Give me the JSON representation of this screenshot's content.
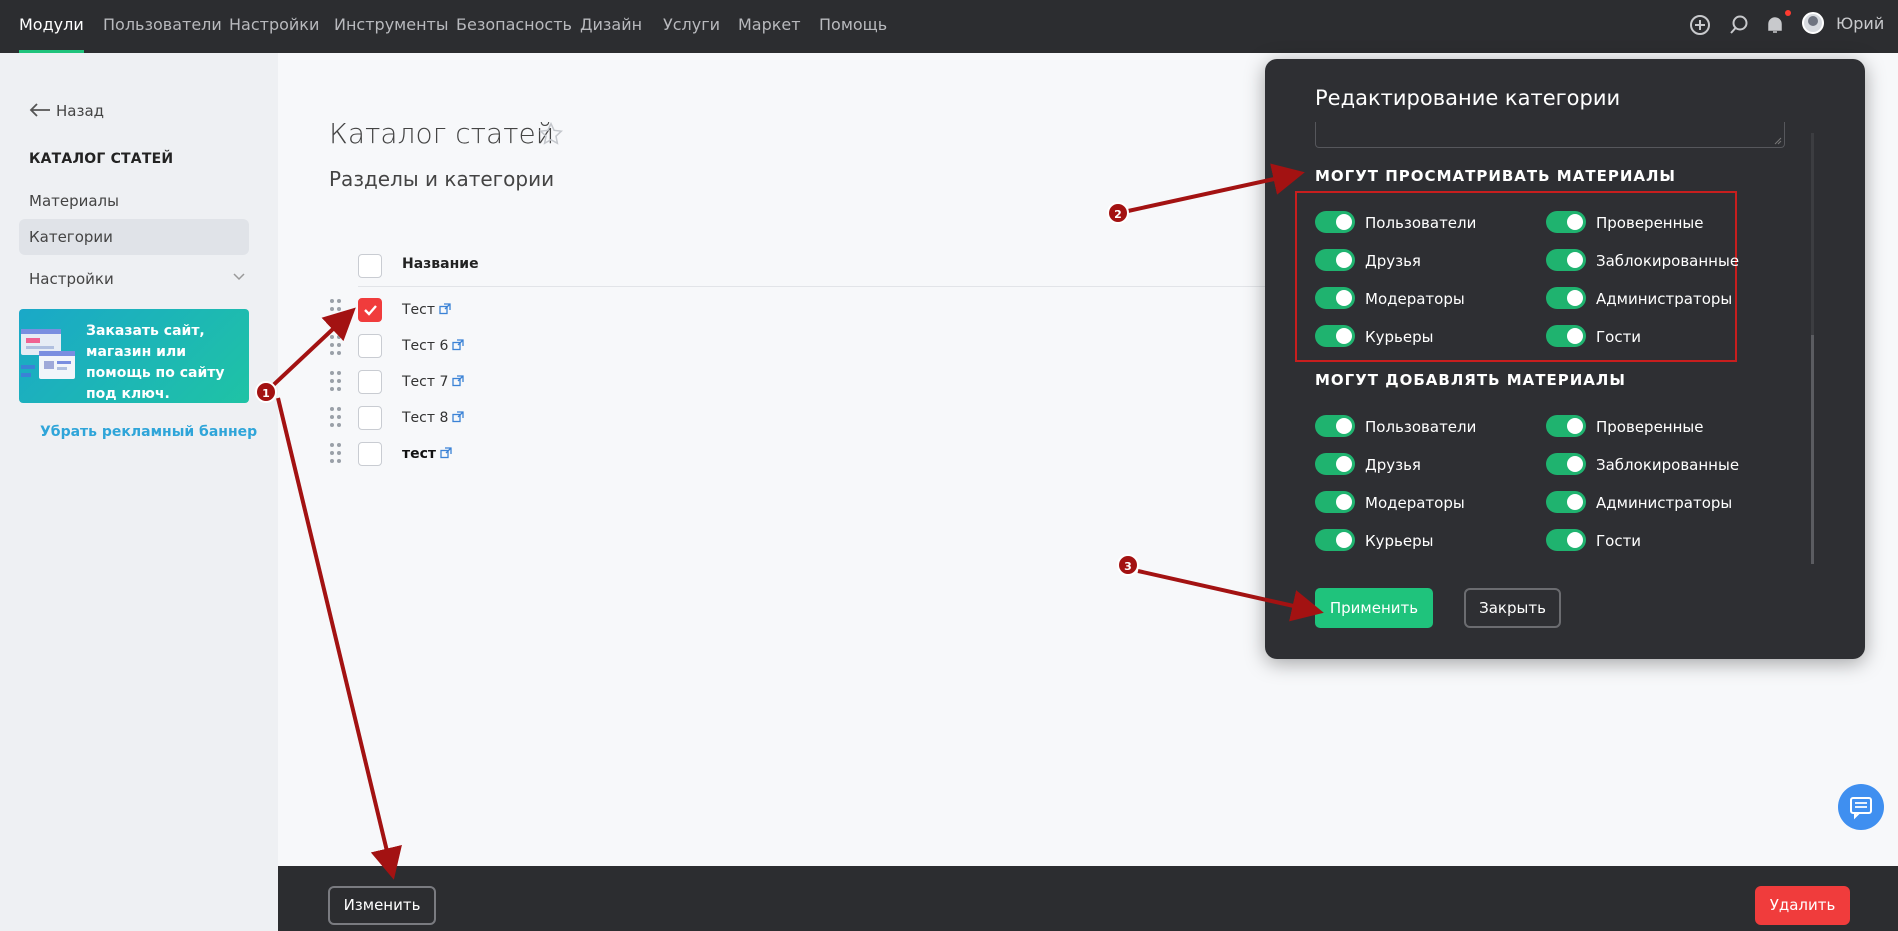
{
  "nav": {
    "items": [
      {
        "label": "Модули",
        "active": true
      },
      {
        "label": "Пользователи"
      },
      {
        "label": "Настройки"
      },
      {
        "label": "Инструменты"
      },
      {
        "label": "Безопасность"
      },
      {
        "label": "Дизайн"
      },
      {
        "label": "Услуги"
      },
      {
        "label": "Маркет"
      },
      {
        "label": "Помощь"
      }
    ],
    "icons": [
      "plus-circle-icon",
      "search-icon",
      "bell-icon"
    ],
    "user_name": "Юрий"
  },
  "sidebar": {
    "back": "Назад",
    "section": "КАТАЛОГ СТАТЕЙ",
    "items": [
      {
        "label": "Материалы"
      },
      {
        "label": "Категории",
        "active": true
      },
      {
        "label": "Настройки",
        "has_submenu": true
      }
    ],
    "promo_text": "Заказать сайт, магазин или помощь по сайту под ключ.",
    "remove_banner": "Убрать рекламный баннер"
  },
  "main": {
    "title": "Каталог статей",
    "subtitle": "Разделы и категории",
    "column_header": "Название",
    "rows": [
      {
        "label": "Тест",
        "checked": true,
        "bold": false
      },
      {
        "label": "Тест 6",
        "checked": false,
        "bold": false
      },
      {
        "label": "Тест 7",
        "checked": false,
        "bold": false
      },
      {
        "label": "Тест 8",
        "checked": false,
        "bold": false
      },
      {
        "label": "тест",
        "checked": false,
        "bold": true
      }
    ]
  },
  "bottom_bar": {
    "edit": "Изменить",
    "delete": "Удалить"
  },
  "modal": {
    "title": "Редактирование категории",
    "view_section": {
      "title": "МОГУТ ПРОСМАТРИВАТЬ МАТЕРИАЛЫ",
      "items": [
        {
          "label": "Пользователи",
          "on": true
        },
        {
          "label": "Проверенные",
          "on": true
        },
        {
          "label": "Друзья",
          "on": true
        },
        {
          "label": "Заблокированные",
          "on": true
        },
        {
          "label": "Модераторы",
          "on": true
        },
        {
          "label": "Администраторы",
          "on": true
        },
        {
          "label": "Курьеры",
          "on": true
        },
        {
          "label": "Гости",
          "on": true
        }
      ]
    },
    "add_section": {
      "title": "МОГУТ ДОБАВЛЯТЬ МАТЕРИАЛЫ",
      "items": [
        {
          "label": "Пользователи",
          "on": true
        },
        {
          "label": "Проверенные",
          "on": true
        },
        {
          "label": "Друзья",
          "on": true
        },
        {
          "label": "Заблокированные",
          "on": true
        },
        {
          "label": "Модераторы",
          "on": true
        },
        {
          "label": "Администраторы",
          "on": true
        },
        {
          "label": "Курьеры",
          "on": true
        },
        {
          "label": "Гости",
          "on": true
        }
      ]
    },
    "apply": "Применить",
    "close": "Закрыть"
  },
  "annotations": [
    {
      "number": "1"
    },
    {
      "number": "2"
    },
    {
      "number": "3"
    }
  ],
  "colors": {
    "accent_green": "#1fc37c",
    "danger_red": "#f03c3c",
    "topbar_bg": "#2c2d30",
    "annotation_red": "#a31212"
  }
}
